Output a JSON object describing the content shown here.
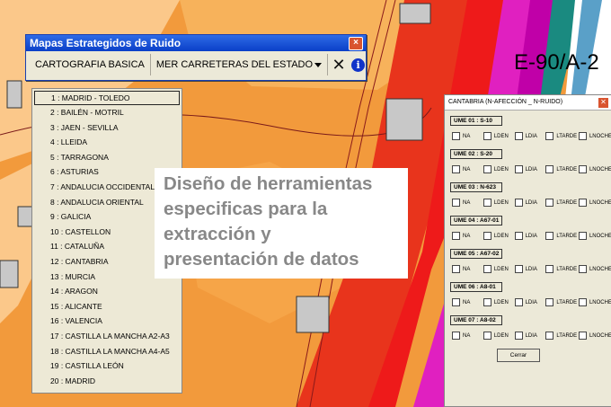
{
  "toolwindow": {
    "title": "Mapas Estrategidos de Ruido",
    "close": "×",
    "buttons": {
      "cartografia": "CARTOGRAFIA BASICA",
      "carreteras": "MER CARRETERAS DEL ESTADO"
    },
    "icons": [
      "close-icon",
      "info-icon"
    ]
  },
  "dropdown": {
    "items": [
      "1 : MADRID - TOLEDO",
      "2 : BAILÉN - MOTRIL",
      "3 : JAEN - SEVILLA",
      "4 : LLEIDA",
      "5 : TARRAGONA",
      "6 : ASTURIAS",
      "7 : ANDALUCIA OCCIDENTAL",
      "8 : ANDALUCIA ORIENTAL",
      "9 : GALICIA",
      "10 : CASTELLON",
      "11 : CATALUÑA",
      "12 : CANTABRIA",
      "13 : MURCIA",
      "14 : ARAGON",
      "15 : ALICANTE",
      "16 : VALENCIA",
      "17 : CASTILLA LA MANCHA A2-A3",
      "18 : CASTILLA LA MANCHA A4-A5",
      "19 : CASTILLA LEÓN",
      "20 : MADRID"
    ],
    "selected": 0
  },
  "caption": {
    "line1": "Diseño de herramientas",
    "line2": "especificas para la",
    "line3": "extracción y",
    "line4": "presentación de datos"
  },
  "map_label": "E-90/A-2",
  "panel": {
    "title": "CANTABRIA (N-AFECCIÓN _ N-RUIDO)",
    "groups": [
      "UME 01 : S-10",
      "UME 02 : S-20",
      "UME 03 : N-623",
      "UME 04 : A67-01",
      "UME 05 : A67-02",
      "UME 06 : A8-01",
      "UME 07 : A8-02"
    ],
    "options": [
      "NA",
      "LDEN",
      "LDIA",
      "LTARDE",
      "LNOCHE"
    ],
    "close_button": "Cerrar"
  }
}
